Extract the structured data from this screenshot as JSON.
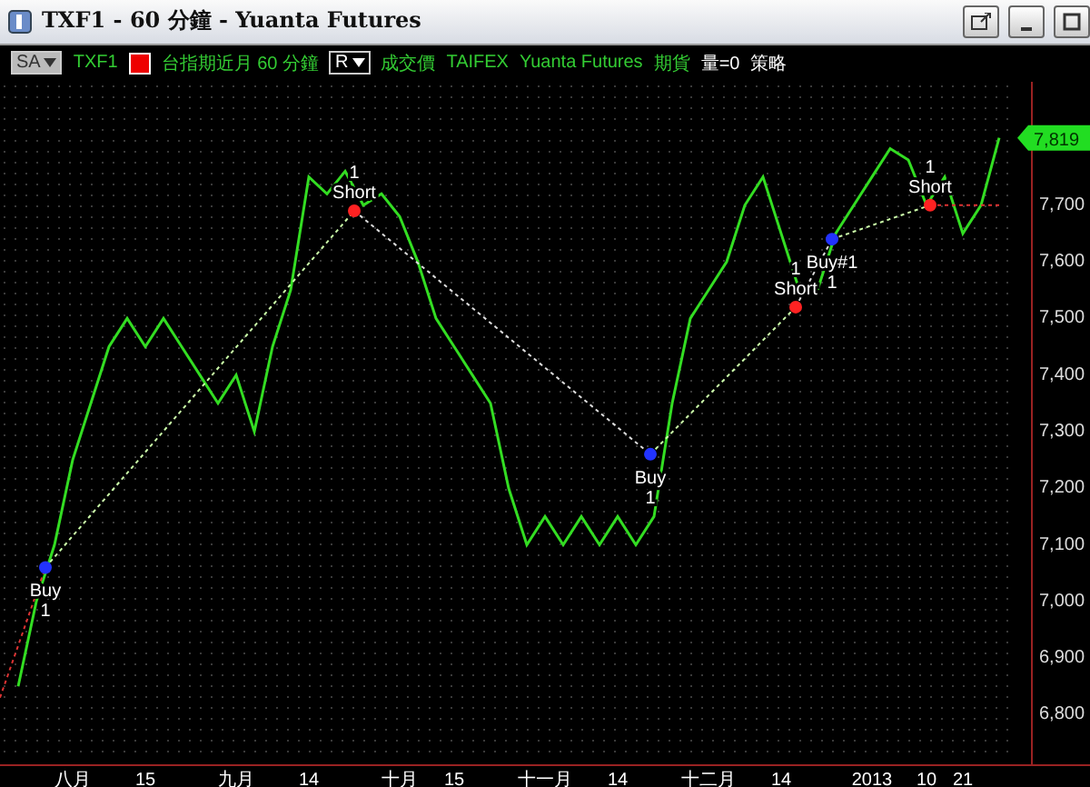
{
  "window": {
    "title": "TXF1 - 60 分鐘 - Yuanta Futures"
  },
  "header": {
    "dropdown_left": "SA",
    "symbol": "TXF1",
    "description": "台指期近月 60 分鐘",
    "dropdown_right": "R",
    "price_field": "成交價",
    "exchange": "TAIFEX",
    "broker": "Yuanta Futures",
    "category": "期貨",
    "volume": "量=0",
    "strategy": "策略"
  },
  "last_price": "7,819",
  "chart": {
    "trades": [
      {
        "kind": "buy",
        "label": "Buy",
        "count": "1"
      },
      {
        "kind": "short",
        "label": "Short",
        "count": "1"
      },
      {
        "kind": "buy",
        "label": "Buy",
        "count": "1"
      },
      {
        "kind": "short",
        "label": "Short",
        "count": "1"
      },
      {
        "kind": "buy",
        "label": "Buy#1",
        "count": "1"
      },
      {
        "kind": "short",
        "label": "Short",
        "count": "1"
      }
    ],
    "chart_data": {
      "type": "line",
      "categories": [
        null,
        null,
        null,
        "八月",
        null,
        null,
        null,
        "15",
        null,
        null,
        null,
        null,
        "九月",
        null,
        null,
        null,
        "14",
        null,
        null,
        null,
        null,
        "十月",
        null,
        null,
        "15",
        null,
        null,
        null,
        null,
        "十一月",
        null,
        null,
        null,
        "14",
        null,
        null,
        null,
        null,
        "十二月",
        null,
        null,
        null,
        "14",
        null,
        null,
        null,
        null,
        "2013",
        null,
        null,
        "10",
        null,
        "21",
        null,
        null
      ],
      "series": [
        {
          "color": "#33dd22",
          "values": [
            6850,
            7000,
            7100,
            7250,
            7350,
            7450,
            7500,
            7450,
            7500,
            7450,
            7400,
            7350,
            7400,
            7300,
            7450,
            7550,
            7750,
            7720,
            7760,
            7700,
            7720,
            7680,
            7600,
            7500,
            7450,
            7400,
            7350,
            7200,
            7100,
            7150,
            7100,
            7150,
            7100,
            7150,
            7100,
            7150,
            7350,
            7500,
            7550,
            7600,
            7700,
            7750,
            7650,
            7550,
            7550,
            7650,
            7700,
            7750,
            7800,
            7780,
            7700,
            7750,
            7650,
            7700,
            7819
          ]
        }
      ],
      "ylim": [
        6730,
        7918
      ],
      "yticks": [
        {
          "value": 6800,
          "label": "6,800"
        },
        {
          "value": 6900,
          "label": "6,900"
        },
        {
          "value": 7000,
          "label": "7,000"
        },
        {
          "value": 7100,
          "label": "7,100"
        },
        {
          "value": 7200,
          "label": "7,200"
        },
        {
          "value": 7300,
          "label": "7,300"
        },
        {
          "value": 7400,
          "label": "7,400"
        },
        {
          "value": 7500,
          "label": "7,500"
        },
        {
          "value": 7600,
          "label": "7,600"
        },
        {
          "value": 7700,
          "label": "7,700"
        }
      ]
    }
  }
}
